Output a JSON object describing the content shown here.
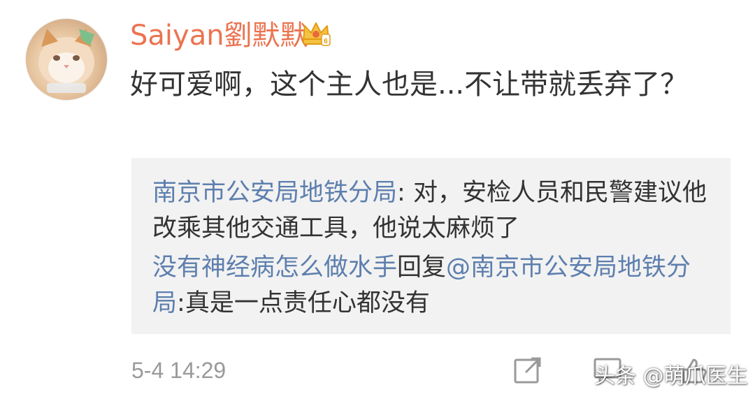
{
  "comment": {
    "username": "Saiyan劉默默",
    "text": "好可爱啊，这个主人也是...不让带就丢弃了？",
    "timestamp": "5-4 14:29"
  },
  "replies": [
    {
      "author": "南京市公安局地铁分局",
      "separator": ": ",
      "text": "对，安检人员和民警建议他改乘其他交通工具，他说太麻烦了"
    },
    {
      "author": "没有神经病怎么做水手",
      "reply_word": "回复",
      "mention": "@南京市公安局地铁分局",
      "separator": ":",
      "text": "真是一点责任心都没有"
    }
  ],
  "watermark": "头条 @萌爪医生",
  "colors": {
    "username": "#eb7350",
    "link": "#5d7fae",
    "body_text": "#333333",
    "meta_text": "#9a9a9a",
    "reply_bg": "#f2f2f2",
    "crown": "#f5b731"
  },
  "icons": {
    "avatar": "cat-photo-avatar",
    "badge": "vip-crown-icon",
    "forward": "forward-icon",
    "comment": "comment-icon",
    "like": "like-icon"
  }
}
